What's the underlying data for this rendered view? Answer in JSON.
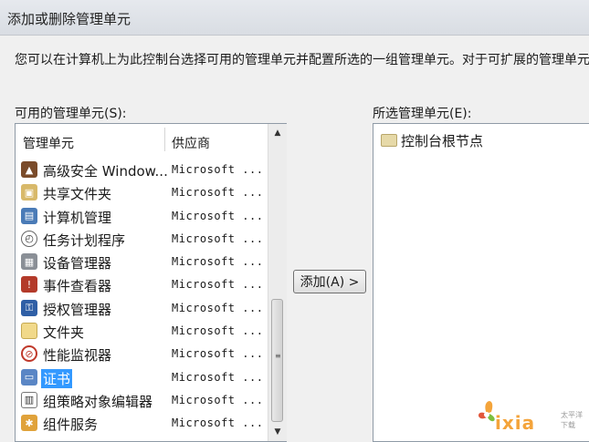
{
  "window": {
    "title": "添加或删除管理单元"
  },
  "description": "您可以在计算机上为此控制台选择可用的管理单元并配置所选的一组管理单元。对于可扩展的管理单元，您可以配置要启用哪些扩展项。",
  "available": {
    "label": "可用的管理单元(S):",
    "columns": {
      "name": "管理单元",
      "vendor": "供应商"
    },
    "rows": [
      {
        "name": "高级安全 Window...",
        "vendor": "Microsoft ...",
        "icon": "firewall-icon"
      },
      {
        "name": "共享文件夹",
        "vendor": "Microsoft ...",
        "icon": "shared-folder-icon"
      },
      {
        "name": "计算机管理",
        "vendor": "Microsoft ...",
        "icon": "computer-management-icon"
      },
      {
        "name": "任务计划程序",
        "vendor": "Microsoft ...",
        "icon": "clock-icon"
      },
      {
        "name": "设备管理器",
        "vendor": "Microsoft ...",
        "icon": "device-manager-icon"
      },
      {
        "name": "事件查看器",
        "vendor": "Microsoft ...",
        "icon": "event-viewer-icon"
      },
      {
        "name": "授权管理器",
        "vendor": "Microsoft ...",
        "icon": "authorization-icon"
      },
      {
        "name": "文件夹",
        "vendor": "Microsoft ...",
        "icon": "folder-icon"
      },
      {
        "name": "性能监视器",
        "vendor": "Microsoft ...",
        "icon": "performance-icon"
      },
      {
        "name": "证书",
        "vendor": "Microsoft ...",
        "icon": "certificate-icon"
      },
      {
        "name": "组策略对象编辑器",
        "vendor": "Microsoft ...",
        "icon": "group-policy-icon"
      },
      {
        "name": "组件服务",
        "vendor": "Microsoft ...",
        "icon": "component-services-icon"
      }
    ],
    "selected_index": 9
  },
  "add_button": {
    "label": "添加(A) >"
  },
  "selected": {
    "label": "所选管理单元(E):",
    "items": [
      {
        "name": "控制台根节点",
        "icon": "folder-icon"
      }
    ]
  },
  "watermark": {
    "text": "ixia",
    "tag": "太平洋下载"
  },
  "colors": {
    "selection": "#3399ff",
    "background": "#f0f0f0"
  }
}
